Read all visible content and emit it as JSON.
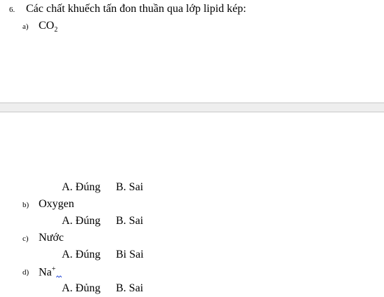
{
  "question": {
    "number": "6.",
    "text": "Các chất khuếch tấn đon thuần qua lớp lipid kép:"
  },
  "items": [
    {
      "label": "a)",
      "name": "CO",
      "sub": "2"
    },
    {
      "label": "b)",
      "name": "Oxygen"
    },
    {
      "label": "c)",
      "name": "Nước"
    },
    {
      "label": "d)",
      "name": "Na",
      "sup": "+"
    }
  ],
  "answers": [
    {
      "a": "A. Đúng",
      "b": "B. Sai"
    },
    {
      "a": "A. Đúng",
      "b": "B. Sai"
    },
    {
      "a": "A. Đúng",
      "b": "Bi Sai"
    },
    {
      "a": "A. Đủng",
      "b": "B. Sai"
    }
  ]
}
